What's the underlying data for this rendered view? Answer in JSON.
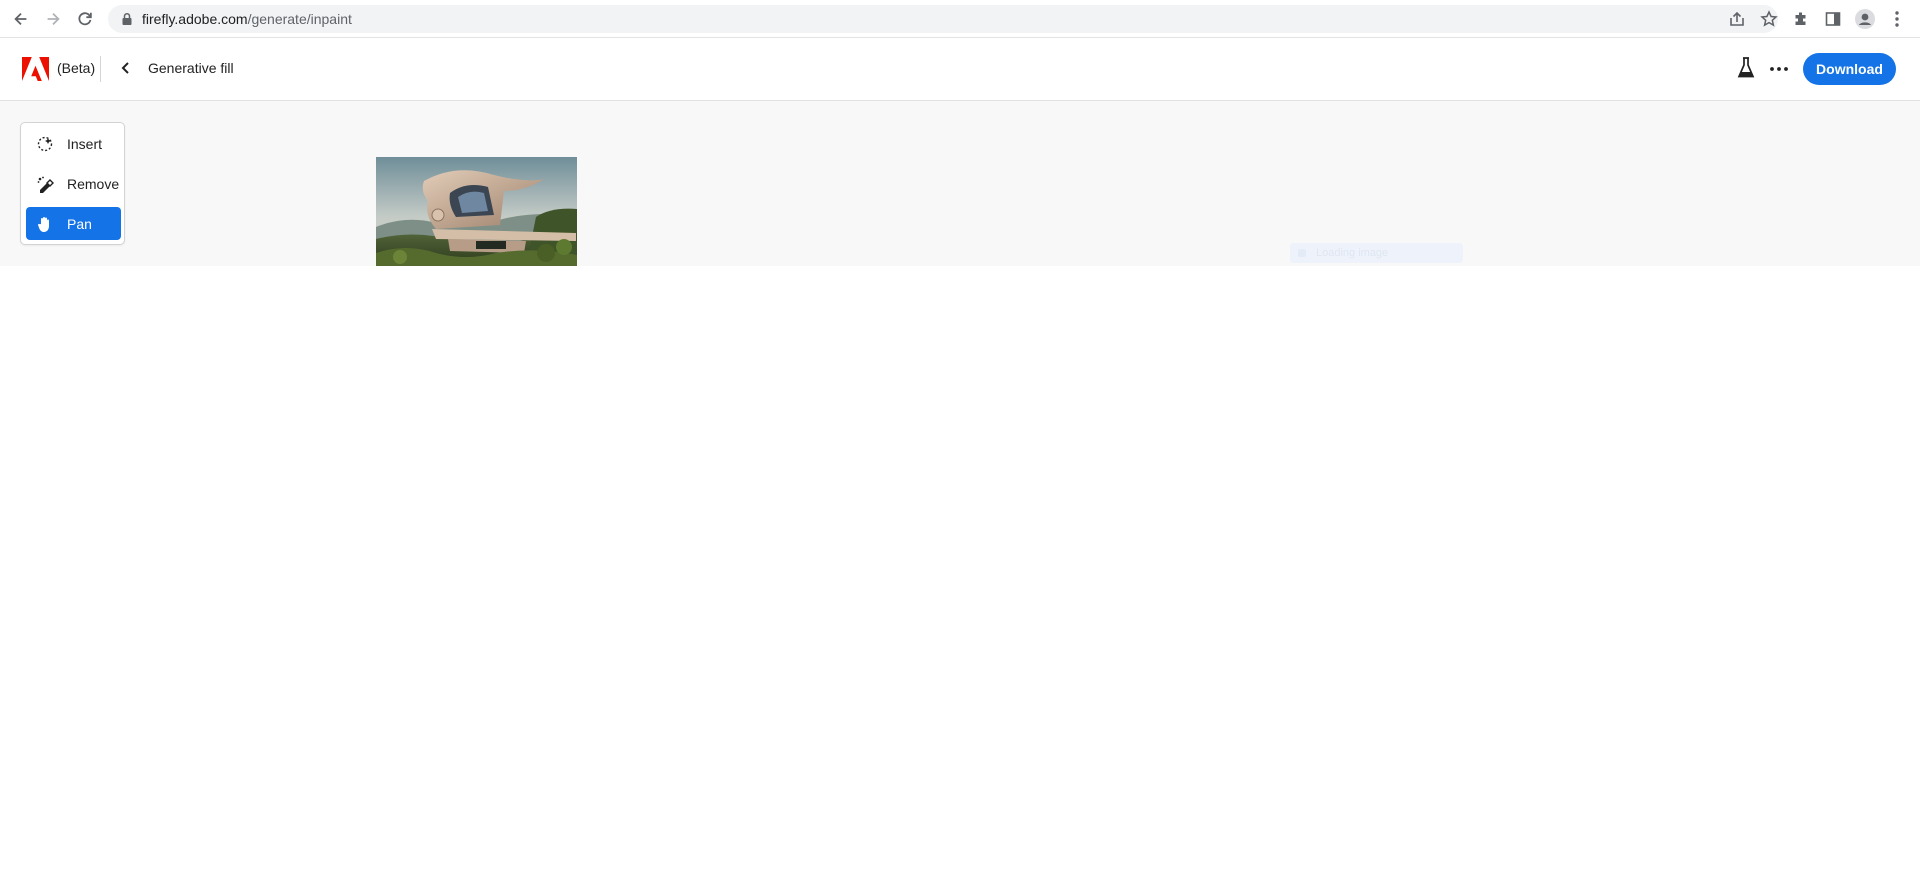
{
  "browser": {
    "url_host": "firefly.adobe.com",
    "url_path": "/generate/inpaint"
  },
  "header": {
    "badge": "(Beta)",
    "title": "Generative fill",
    "download_label": "Download"
  },
  "tools": [
    {
      "label": "Insert",
      "icon": "insert-brush-icon",
      "active": false
    },
    {
      "label": "Remove",
      "icon": "eraser-icon",
      "active": false
    },
    {
      "label": "Pan",
      "icon": "hand-icon",
      "active": true
    }
  ],
  "canvas": {
    "image": "modern-curved-house-on-hillside",
    "ghost_chip_label": "Loading image"
  },
  "colors": {
    "accent": "#1473e6",
    "adobe_red": "#eb1000",
    "workspace": "#f8f8f8"
  }
}
